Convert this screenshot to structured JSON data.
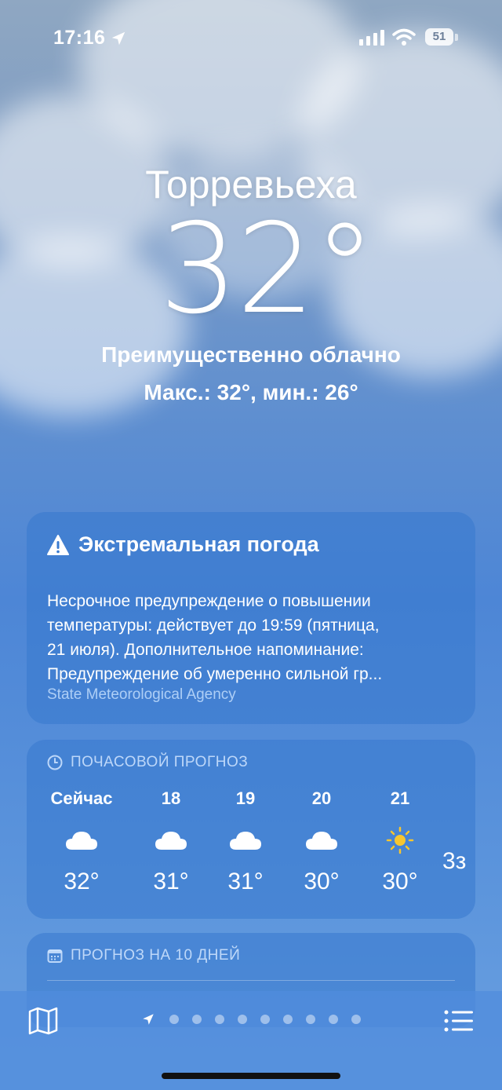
{
  "status_bar": {
    "time": "17:16",
    "battery": "51"
  },
  "header": {
    "city": "Торревьеха",
    "temperature": "32°",
    "condition": "Преимущественно облачно",
    "high_low": "Макс.: 32°, мин.: 26°"
  },
  "alert": {
    "title": "Экстремальная погода",
    "lines": [
      "Несрочное предупреждение о повышении",
      "температуры: действует до 19:59 (пятница,",
      "21 июля). Дополнительное напоминание:",
      "Предупреждение об умеренно сильной гр..."
    ],
    "source": "State Meteorological Agency"
  },
  "hourly": {
    "title": "ПОЧАСОВОЙ ПРОГНОЗ",
    "items": [
      {
        "label": "Сейчас",
        "icon": "cloud-icon",
        "temp": "32°"
      },
      {
        "label": "18",
        "icon": "cloud-icon",
        "temp": "31°"
      },
      {
        "label": "19",
        "icon": "cloud-icon",
        "temp": "31°"
      },
      {
        "label": "20",
        "icon": "cloud-icon",
        "temp": "30°"
      },
      {
        "label": "21",
        "icon": "sun-icon",
        "temp": "30°"
      },
      {
        "label": "",
        "icon": "",
        "temp": "3з"
      }
    ]
  },
  "daily": {
    "title": "ПРОГНОЗ НА 10 ДНЕЙ"
  },
  "bottom_bar": {
    "page_dots": 9,
    "icons": [
      "map-icon",
      "location-arrow-icon",
      "list-icon"
    ]
  },
  "colors": {
    "sun": "#f7c62f",
    "card": "#3678cd"
  }
}
